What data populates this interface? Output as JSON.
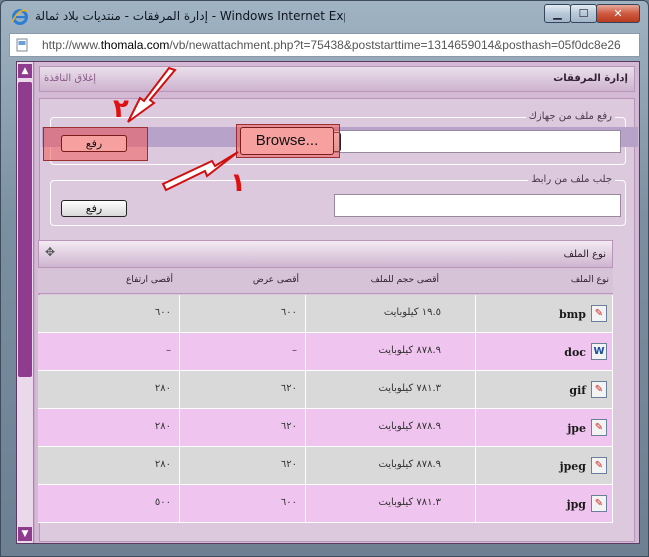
{
  "window": {
    "title": "إدارة المرفقات - منتديات بلاد ثمالة - Windows Internet Explorer",
    "controls": {
      "minimize": "▁",
      "maximize": "☐",
      "close": "✕"
    },
    "address": {
      "url_prefix": "http://www.",
      "url_host": "thomala.com",
      "url_rest": "/vb/newattachment.php?t=75438&poststarttime=1314659014&posthash=05f0dc8e26"
    }
  },
  "page": {
    "close_window_link": "إغلاق النافذة",
    "manage_title": "إدارة المرفقات",
    "upload_section": {
      "legend": "رفع ملف من جهازك",
      "browse_label": "Browse...",
      "upload_label": "رفع"
    },
    "url_section": {
      "legend": "جلب ملف من رابط",
      "url_value": "",
      "fetch_label": "رفع"
    },
    "annotations": {
      "number_1": "١",
      "number_2": "٢"
    },
    "table": {
      "caption": "نوع الملف",
      "move_icon": "✥",
      "headers": {
        "type": "نوع الملف",
        "max_size": "أقصى حجم للملف",
        "max_width": "أقصى عرض",
        "max_height": "أقصى ارتفاع"
      },
      "rows": [
        {
          "ext": "bmp",
          "icon": "paint-file-icon",
          "glyph": "✎",
          "size": "١٩.٥ كيلوبايت",
          "width": "٦٠٠",
          "height": "٦٠٠"
        },
        {
          "ext": "doc",
          "icon": "word-file-icon",
          "glyph": "W",
          "size": "٨٧٨.٩ كيلوبايت",
          "width": "–",
          "height": "–"
        },
        {
          "ext": "gif",
          "icon": "paint-file-icon",
          "glyph": "✎",
          "size": "٧٨١.٣ كيلوبايت",
          "width": "٦٢٠",
          "height": "٢٨٠"
        },
        {
          "ext": "jpe",
          "icon": "paint-file-icon",
          "glyph": "✎",
          "size": "٨٧٨.٩ كيلوبايت",
          "width": "٦٢٠",
          "height": "٢٨٠"
        },
        {
          "ext": "jpeg",
          "icon": "paint-file-icon",
          "glyph": "✎",
          "size": "٨٧٨.٩ كيلوبايت",
          "width": "٦٢٠",
          "height": "٢٨٠"
        },
        {
          "ext": "jpg",
          "icon": "paint-file-icon",
          "glyph": "✎",
          "size": "٧٨١.٣ كيلوبايت",
          "width": "٦٠٠",
          "height": "٥٠٠"
        }
      ]
    }
  },
  "colors": {
    "accent": "#8f3b8e",
    "highlight": "#f05a5a",
    "annotation_red": "#e01010"
  }
}
